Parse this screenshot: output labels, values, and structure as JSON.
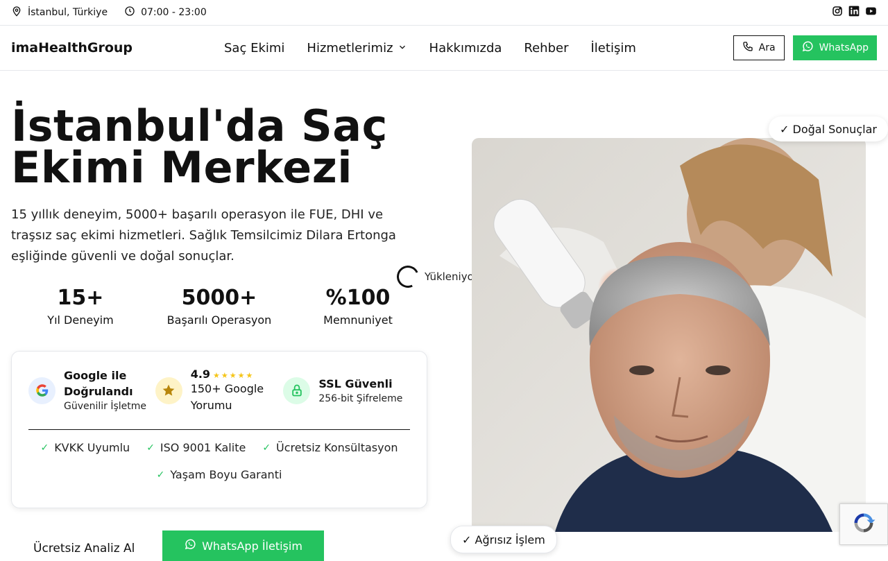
{
  "topbar": {
    "location": "İstanbul, Türkiye",
    "hours": "07:00 - 23:00",
    "social": [
      "instagram-icon",
      "linkedin-icon",
      "youtube-icon"
    ]
  },
  "header": {
    "brand": "imaHealthGroup",
    "nav": [
      {
        "label": "Saç Ekimi"
      },
      {
        "label": "Hizmetlerimiz",
        "has_dropdown": true
      },
      {
        "label": "Hakkımızda"
      },
      {
        "label": "Rehber"
      },
      {
        "label": "İletişim"
      }
    ],
    "call_label": "Ara",
    "whatsapp_label": "WhatsApp"
  },
  "hero": {
    "title": "İstanbul'da Saç Ekimi Merkezi",
    "description": "15 yıllık deneyim, 5000+ başarılı operasyon ile FUE, DHI ve traşsız saç ekimi hizmetleri. Sağlık Temsilcimiz Dilara Ertonga eşliğinde güvenli ve doğal sonuçlar.",
    "stats": [
      {
        "value": "15+",
        "label": "Yıl Deneyim"
      },
      {
        "value": "5000+",
        "label": "Başarılı Operasyon"
      },
      {
        "value": "%100",
        "label": "Memnuniyet"
      }
    ],
    "loading_text": "Yükleniyor...",
    "badge_top": "✓ Doğal Sonuçlar",
    "badge_bottom": "✓ Ağrısız İşlem"
  },
  "trust": {
    "google": {
      "title": "Google ile Doğrulandı",
      "subtitle": "Güvenilir İşletme"
    },
    "rating": {
      "value": "4.9",
      "stars": 5,
      "label": "150+ Google Yorumu"
    },
    "ssl": {
      "title": "SSL Güvenli",
      "subtitle": "256-bit Şifreleme"
    },
    "checks": [
      "KVKK Uyumlu",
      "ISO 9001 Kalite",
      "Ücretsiz Konsültasyon",
      "Yaşam Boyu Garanti"
    ]
  },
  "cta": {
    "text": "Ücretsiz Analiz Al",
    "whatsapp_label": "WhatsApp İletişim"
  },
  "colors": {
    "whatsapp": "#25c35f",
    "google_blue": "#4285f4",
    "star": "#f5c518",
    "lock_green": "#25c35f"
  }
}
